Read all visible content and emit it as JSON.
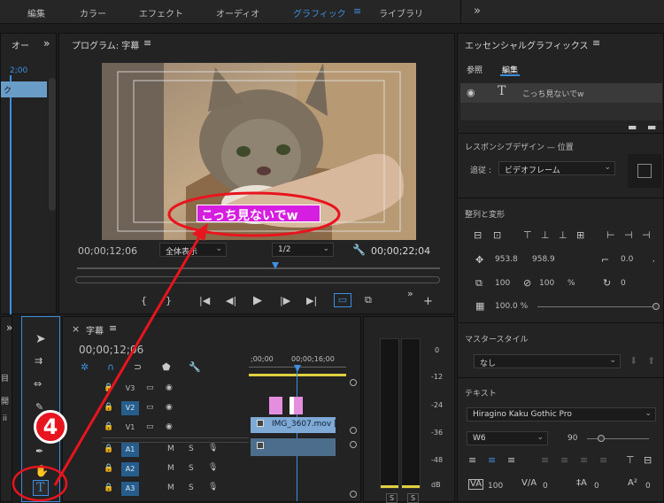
{
  "workspace_tabs": [
    "編集",
    "カラー",
    "エフェクト",
    "オーディオ",
    "グラフィック",
    "ライブラリ"
  ],
  "workspace_active": "グラフィック",
  "menu_icon": "hamburger-icon",
  "more_label": "»",
  "left_panel": {
    "title": "オー",
    "timecode": "2;00",
    "track_label": "ク"
  },
  "program": {
    "title": "プログラム: 字幕",
    "current_tc": "00;00;12;06",
    "fit_label": "全体表示",
    "res_label": "1/2",
    "duration_tc": "00;00;22;04",
    "caption_text": "こっち見ないでw"
  },
  "essential_graphics": {
    "title": "エッセンシャルグラフィックス",
    "tab_browse": "参照",
    "tab_edit": "編集",
    "layer_name": "こっち見ないでw",
    "responsive_label": "レスポンシブデザイン — 位置",
    "follow_label": "追従 :",
    "follow_value": "ビデオフレーム",
    "align_label": "整列と変形",
    "pos_x": "953.8",
    "pos_y": "958.9",
    "anchor_x": "0.0",
    "anchor_y": ",",
    "scale_w": "100",
    "scale_h": "100",
    "pct": "%",
    "rotation": "0",
    "opacity": "100.0 %",
    "master_label": "マスタースタイル",
    "master_value": "なし",
    "text_label": "テキスト",
    "font_name": "Hiragino Kaku Gothic Pro",
    "font_weight": "W6",
    "font_size": "90",
    "tracking": "100",
    "kerning": "0",
    "leading": "0",
    "baseline": "0"
  },
  "timeline": {
    "title": "字幕",
    "current_tc": "00;00;12;06",
    "ruler_start": ";00;00",
    "ruler_mid": "00;00;16;00",
    "tracks_video": [
      "V3",
      "V2",
      "V1"
    ],
    "tracks_audio": [
      "A1",
      "A2",
      "A3"
    ],
    "clip_name": "IMG_3607.mov [",
    "m_label": "M",
    "s_label": "S"
  },
  "audio_meter": {
    "ticks": [
      "0",
      "-12",
      "-24",
      "-36",
      "-48",
      "dB"
    ],
    "s_label": "S"
  },
  "left_tools": {
    "labels": [
      "目",
      "開",
      "ii"
    ]
  },
  "annotation": {
    "number": "4"
  },
  "colors": {
    "accent": "#3d8fe0",
    "annotation": "#e8141e",
    "caption": "#d61ee0",
    "clip_video": "#7faad6",
    "clip_pink": "#e48ee0"
  }
}
